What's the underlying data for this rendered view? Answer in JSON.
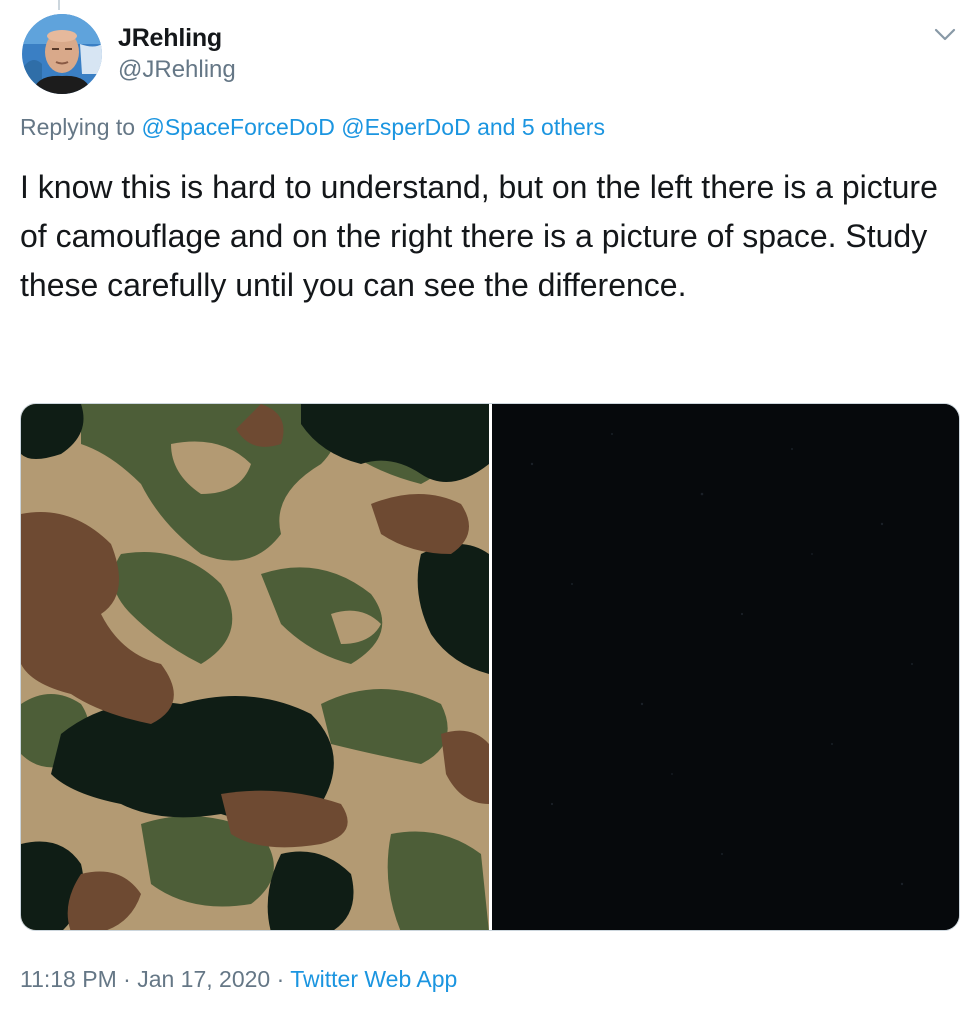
{
  "user": {
    "display_name": "JRehling",
    "handle": "@JRehling"
  },
  "reply": {
    "prefix": "Replying to",
    "mentions": [
      "@SpaceForceDoD",
      "@EsperDoD"
    ],
    "others": "and 5 others"
  },
  "tweet": {
    "text": "I know this is hard to understand, but on the left there is a picture of camouflage and on the right there is a picture of space. Study these carefully until you can see the difference."
  },
  "meta": {
    "time": "11:18 PM",
    "sep1": " · ",
    "date": "Jan 17, 2020",
    "sep2": " · ",
    "app": "Twitter Web App"
  },
  "colors": {
    "link": "#1b95e0",
    "muted": "#657786",
    "camo_tan": "#b39a73",
    "camo_green": "#4d5e38",
    "camo_brown": "#6e4a32",
    "camo_dark": "#0f1d15",
    "space": "#06090c"
  },
  "icons": {
    "caret": "chevron-down-icon",
    "avatar": "profile-avatar"
  }
}
